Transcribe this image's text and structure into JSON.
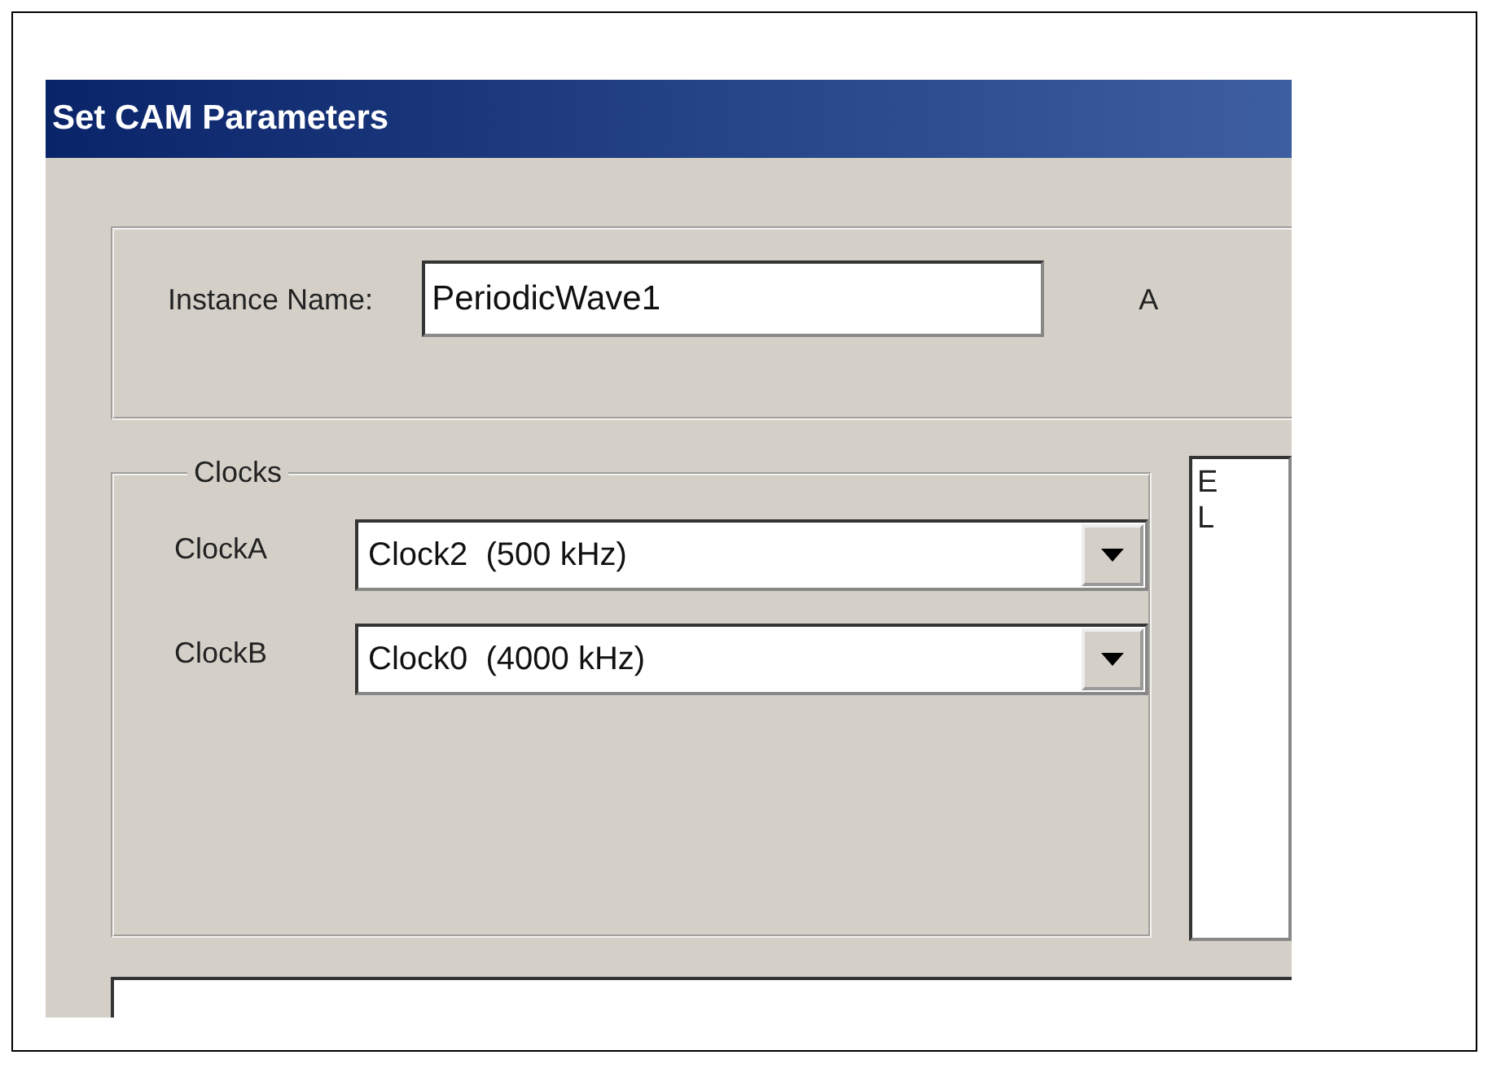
{
  "window": {
    "title": "Set CAM Parameters"
  },
  "instance": {
    "label": "Instance Name:",
    "value": "PeriodicWave1",
    "label_2": "A"
  },
  "clocks": {
    "title": "Clocks",
    "rows": [
      {
        "label": "ClockA",
        "value": "Clock2  (500 kHz)"
      },
      {
        "label": "ClockB",
        "value": "Clock0  (4000 kHz)"
      }
    ]
  },
  "list": {
    "items": [
      "E",
      "L"
    ]
  }
}
